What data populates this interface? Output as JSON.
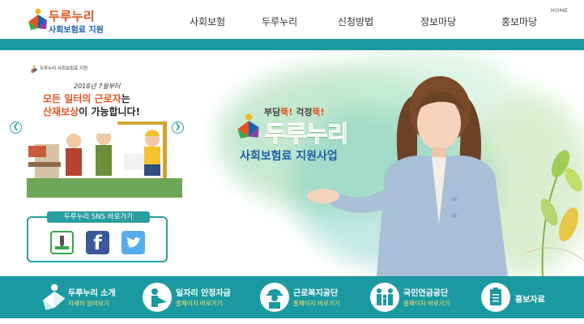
{
  "header": {
    "logo_line1": "두루누리",
    "logo_line2": "사회보험료 지원",
    "home_link": "HOME",
    "nav": [
      {
        "label": "사회보험"
      },
      {
        "label": "두루누리"
      },
      {
        "label": "신청방법"
      },
      {
        "label": "정보마당"
      },
      {
        "label": "홍보마당"
      }
    ]
  },
  "banner": {
    "logo_text": "두루누리 사회보험료 지원",
    "date_text": "2018년 7월부터",
    "headline1_a": "모든 일터의 근로자",
    "headline1_b": "는",
    "headline2_a": "산재보상",
    "headline2_b": "이 가능합니다!",
    "prev_icon": "chevron-left-icon",
    "next_icon": "chevron-right-icon"
  },
  "hero": {
    "tagline_a": "부담",
    "tagline_b": "뚝!",
    "tagline_c": " 걱정",
    "tagline_d": "뚝!",
    "title": "두루누리",
    "subtitle": "사회보험료 지원사업"
  },
  "sns": {
    "label": "두루누리 SNS 바로가기",
    "links": [
      {
        "name": "blog",
        "icon": "blog-icon"
      },
      {
        "name": "facebook",
        "icon": "facebook-icon"
      },
      {
        "name": "twitter",
        "icon": "twitter-icon"
      }
    ]
  },
  "quick_links": [
    {
      "title": "두루누리 소개",
      "sub": "자세히 알아보기"
    },
    {
      "title": "일자리 안정자금",
      "sub": "홈페이지 바로가기"
    },
    {
      "title": "근로복지공단",
      "sub": "홈페이지 바로가기"
    },
    {
      "title": "국민연금공단",
      "sub": "홈페이지 바로가기"
    },
    {
      "title": "홍보자료",
      "sub": ""
    }
  ],
  "colors": {
    "brand_teal": "#1a9aa0",
    "accent_orange": "#e3531f",
    "brand_blue": "#1b5fa9",
    "highlight_yellow": "#ffe36a",
    "hero_green": "#5aa836"
  }
}
